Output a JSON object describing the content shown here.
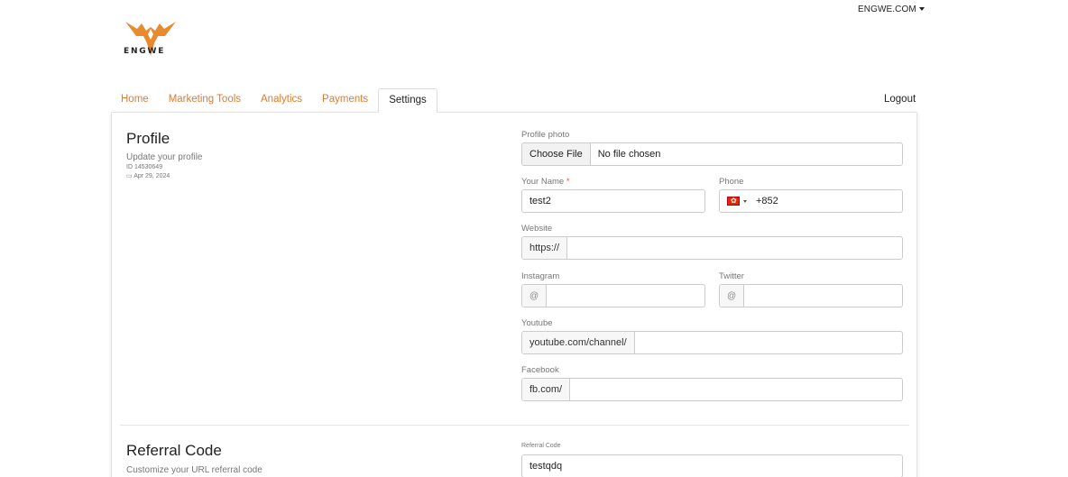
{
  "topbar": {
    "site_link": "ENGWE.COM"
  },
  "brand": {
    "logo_text": "ENGWE",
    "logo_color": "#e88a2e"
  },
  "nav": {
    "tabs": [
      {
        "label": "Home"
      },
      {
        "label": "Marketing Tools"
      },
      {
        "label": "Analytics"
      },
      {
        "label": "Payments"
      },
      {
        "label": "Settings",
        "active": true
      }
    ],
    "logout": "Logout"
  },
  "profile": {
    "title": "Profile",
    "subtitle": "Update your profile",
    "id_text": "ID 14530649",
    "date_text": "Apr 29, 2024",
    "fields": {
      "photo": {
        "label": "Profile photo",
        "button": "Choose File",
        "status": "No file chosen"
      },
      "name": {
        "label": "Your Name",
        "required_mark": "*",
        "value": "test2"
      },
      "phone": {
        "label": "Phone",
        "value": "+852"
      },
      "website": {
        "label": "Website",
        "prefix": "https://",
        "value": ""
      },
      "instagram": {
        "label": "Instagram",
        "prefix": "@",
        "value": ""
      },
      "twitter": {
        "label": "Twitter",
        "prefix": "@",
        "value": ""
      },
      "youtube": {
        "label": "Youtube",
        "prefix": "youtube.com/channel/",
        "value": ""
      },
      "facebook": {
        "label": "Facebook",
        "prefix": "fb.com/",
        "value": ""
      }
    }
  },
  "referral": {
    "title": "Referral Code",
    "subtitle": "Customize your URL referral code",
    "field": {
      "label": "Referral Code",
      "value": "testqdq"
    }
  },
  "colors": {
    "accent": "#e07b2e",
    "required": "#d9534f"
  }
}
